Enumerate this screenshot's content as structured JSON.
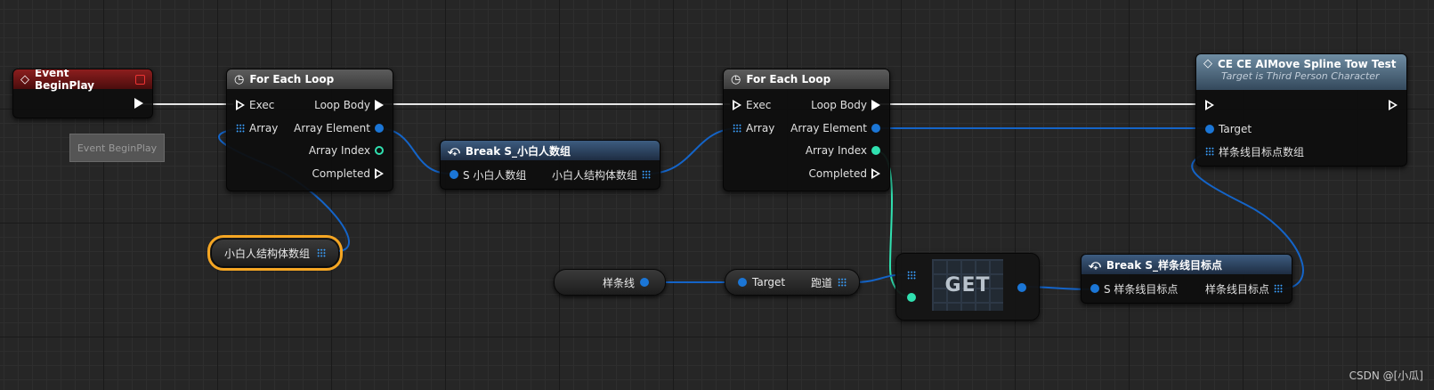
{
  "event_node": {
    "title": "Event BeginPlay"
  },
  "comment": {
    "text": "Event BeginPlay"
  },
  "foreach1": {
    "title": "For Each Loop",
    "exec": "Exec",
    "array": "Array",
    "loop_body": "Loop Body",
    "array_element": "Array Element",
    "array_index": "Array Index",
    "completed": "Completed"
  },
  "foreach2": {
    "title": "For Each Loop",
    "exec": "Exec",
    "array": "Array",
    "loop_body": "Loop Body",
    "array_element": "Array Element",
    "array_index": "Array Index",
    "completed": "Completed"
  },
  "break1": {
    "title": "Break S_小白人数组",
    "input": "S 小白人数组",
    "output": "小白人结构体数组"
  },
  "var_xiaobai": {
    "label": "小白人结构体数组"
  },
  "var_spline": {
    "label": "样条线"
  },
  "target_node": {
    "input": "Target",
    "output": "跑道"
  },
  "get_node": {
    "label": "GET"
  },
  "break2": {
    "title": "Break S_样条线目标点",
    "input": "S 样条线目标点",
    "output": "样条线目标点"
  },
  "func_node": {
    "title": "CE CE AIMove Spline Tow Test",
    "subtitle": "Target is Third Person Character",
    "target": "Target",
    "param": "样条线目标点数组"
  },
  "watermark": "CSDN @[小瓜]",
  "colors": {
    "exec": "#ffffff",
    "object": "#1b76d6",
    "integer": "#30e0b0",
    "event_header": "#8c1e1e",
    "macro_header": "#5c5c5c",
    "struct_header": "#3d5c80",
    "function_header": "#6f8da3",
    "selected_outline": "#f5a623"
  }
}
